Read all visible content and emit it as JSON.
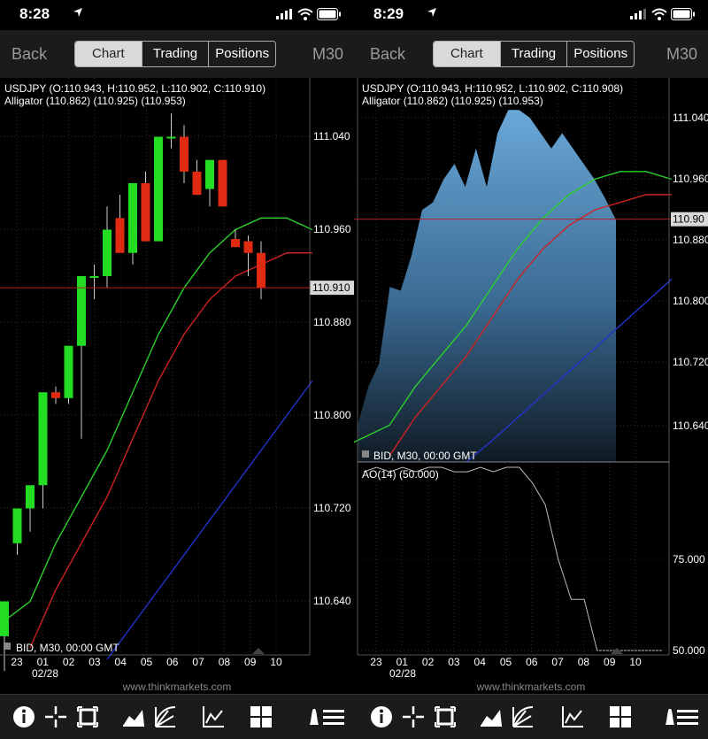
{
  "screens": [
    {
      "status": {
        "time": "8:28"
      },
      "nav": {
        "back": "Back",
        "tabs": [
          "Chart",
          "Trading",
          "Positions"
        ],
        "active": 0,
        "timeframe": "M30"
      },
      "chart": {
        "header": "USDJPY (O:110.943, H:110.952, L:110.902, C:110.910)",
        "indicator": "Alligator (110.862) (110.925) (110.953)",
        "price_labels": [
          "111.040",
          "110.960",
          "110.880",
          "110.800",
          "110.720",
          "110.640"
        ],
        "current_price": "110.910",
        "bid_label": "BID, M30, 00:00 GMT",
        "time_labels": [
          "23",
          "01",
          "02",
          "03",
          "04",
          "05",
          "06",
          "07",
          "08",
          "09",
          "10"
        ],
        "date_label": "02/28",
        "watermark": "www.thinkmarkets.com"
      }
    },
    {
      "status": {
        "time": "8:29"
      },
      "nav": {
        "back": "Back",
        "tabs": [
          "Chart",
          "Trading",
          "Positions"
        ],
        "active": 0,
        "timeframe": "M30"
      },
      "chart": {
        "header": "USDJPY (O:110.943, H:110.952, L:110.902, C:110.908)",
        "indicator": "Alligator (110.862) (110.925) (110.953)",
        "price_labels": [
          "111.040",
          "110.960",
          "110.880",
          "110.800",
          "110.720",
          "110.640"
        ],
        "current_price": "110.90",
        "bid_label": "BID, M30, 00:00 GMT",
        "osc_label": "AO(14) (50.000)",
        "osc_labels": [
          "75.000",
          "50.000"
        ],
        "time_labels": [
          "23",
          "01",
          "02",
          "03",
          "04",
          "05",
          "06",
          "07",
          "08",
          "09",
          "10"
        ],
        "date_label": "02/28",
        "watermark": "www.thinkmarkets.com"
      }
    }
  ],
  "toolbar_icons": [
    "info-icon",
    "crosshair-icon",
    "frame-icon",
    "chart-type-icon",
    "drawing-tools-icon",
    "indicators-icon",
    "layout-grid-icon",
    "menu-icon"
  ],
  "chart_data": [
    {
      "type": "candlestick",
      "title": "USDJPY (O:110.943, H:110.952, L:110.902, C:110.910)",
      "ylim": [
        110.59,
        111.1
      ],
      "candles": [
        {
          "o": 110.61,
          "h": 110.64,
          "l": 110.58,
          "c": 110.64
        },
        {
          "o": 110.69,
          "h": 110.71,
          "l": 110.68,
          "c": 110.72
        },
        {
          "o": 110.72,
          "h": 110.73,
          "l": 110.7,
          "c": 110.74
        },
        {
          "o": 110.74,
          "h": 110.82,
          "l": 110.72,
          "c": 110.82
        },
        {
          "o": 110.82,
          "h": 110.825,
          "l": 110.81,
          "c": 110.815
        },
        {
          "o": 110.815,
          "h": 110.86,
          "l": 110.81,
          "c": 110.86
        },
        {
          "o": 110.86,
          "h": 110.92,
          "l": 110.78,
          "c": 110.92
        },
        {
          "o": 110.92,
          "h": 110.93,
          "l": 110.9,
          "c": 110.92
        },
        {
          "o": 110.92,
          "h": 110.98,
          "l": 110.91,
          "c": 110.96
        },
        {
          "o": 110.97,
          "h": 110.99,
          "l": 110.94,
          "c": 110.94
        },
        {
          "o": 110.94,
          "h": 111.0,
          "l": 110.93,
          "c": 111.0
        },
        {
          "o": 111.0,
          "h": 111.01,
          "l": 110.95,
          "c": 110.95
        },
        {
          "o": 110.95,
          "h": 111.04,
          "l": 110.95,
          "c": 111.04
        },
        {
          "o": 111.04,
          "h": 111.06,
          "l": 111.03,
          "c": 111.04
        },
        {
          "o": 111.04,
          "h": 111.05,
          "l": 111.0,
          "c": 111.01
        },
        {
          "o": 111.01,
          "h": 111.02,
          "l": 110.99,
          "c": 110.99
        },
        {
          "o": 110.995,
          "h": 111.02,
          "l": 110.98,
          "c": 111.02
        },
        {
          "o": 111.02,
          "h": 111.02,
          "l": 110.98,
          "c": 110.98
        },
        {
          "o": 110.952,
          "h": 110.96,
          "l": 110.945,
          "c": 110.945
        },
        {
          "o": 110.95,
          "h": 110.955,
          "l": 110.92,
          "c": 110.94
        },
        {
          "o": 110.94,
          "h": 110.95,
          "l": 110.9,
          "c": 110.91
        }
      ],
      "series": [
        {
          "color": "#2bd12b",
          "values": [
            [
              -2,
              110.59
            ],
            [
              1,
              110.64
            ],
            [
              2,
              110.69
            ],
            [
              4,
              110.77
            ],
            [
              5,
              110.82
            ],
            [
              6,
              110.87
            ],
            [
              7,
              110.91
            ],
            [
              8,
              110.94
            ],
            [
              9,
              110.96
            ],
            [
              10,
              110.97
            ],
            [
              11,
              110.97
            ],
            [
              12,
              110.96
            ]
          ]
        },
        {
          "color": "#cc2222",
          "values": [
            [
              1,
              110.6
            ],
            [
              2,
              110.65
            ],
            [
              4,
              110.73
            ],
            [
              5,
              110.78
            ],
            [
              6,
              110.83
            ],
            [
              7,
              110.87
            ],
            [
              8,
              110.9
            ],
            [
              9,
              110.92
            ],
            [
              10,
              110.93
            ],
            [
              11,
              110.94
            ],
            [
              12,
              110.94
            ]
          ]
        },
        {
          "color": "#2233cc",
          "values": [
            [
              4,
              110.59
            ],
            [
              5,
              110.62
            ],
            [
              6,
              110.65
            ],
            [
              7,
              110.68
            ],
            [
              8,
              110.71
            ],
            [
              9,
              110.74
            ],
            [
              10,
              110.77
            ],
            [
              11,
              110.8
            ],
            [
              12,
              110.83
            ]
          ]
        }
      ]
    },
    {
      "type": "area",
      "title": "USDJPY (O:110.943, H:110.952, L:110.902, C:110.908)",
      "ylim": [
        110.59,
        111.1
      ],
      "close": [
        110.64,
        110.69,
        110.72,
        110.82,
        110.815,
        110.86,
        110.92,
        110.93,
        110.96,
        110.98,
        110.95,
        111.0,
        110.95,
        111.02,
        111.05,
        111.05,
        111.04,
        111.02,
        111.0,
        111.02,
        111.0,
        110.98,
        110.96,
        110.935,
        110.907
      ],
      "alligator": [
        {
          "color": "#2bd12b",
          "values": [
            [
              -2,
              110.59
            ],
            [
              1,
              110.64
            ],
            [
              2,
              110.69
            ],
            [
              4,
              110.77
            ],
            [
              5,
              110.82
            ],
            [
              6,
              110.87
            ],
            [
              7,
              110.91
            ],
            [
              8,
              110.94
            ],
            [
              9,
              110.96
            ],
            [
              10,
              110.97
            ],
            [
              11,
              110.97
            ],
            [
              12,
              110.96
            ]
          ]
        },
        {
          "color": "#cc2222",
          "values": [
            [
              1,
              110.6
            ],
            [
              2,
              110.65
            ],
            [
              4,
              110.73
            ],
            [
              5,
              110.78
            ],
            [
              6,
              110.83
            ],
            [
              7,
              110.87
            ],
            [
              8,
              110.9
            ],
            [
              9,
              110.92
            ],
            [
              10,
              110.93
            ],
            [
              11,
              110.94
            ],
            [
              12,
              110.94
            ]
          ]
        },
        {
          "color": "#2233cc",
          "values": [
            [
              4,
              110.59
            ],
            [
              5,
              110.62
            ],
            [
              6,
              110.65
            ],
            [
              7,
              110.68
            ],
            [
              8,
              110.71
            ],
            [
              9,
              110.74
            ],
            [
              10,
              110.77
            ],
            [
              11,
              110.8
            ],
            [
              12,
              110.83
            ]
          ]
        }
      ],
      "oscillator": {
        "name": "AO(14)",
        "ylim": [
          50,
          80
        ],
        "values": [
          [
            -1,
            99
          ],
          [
            -0.5,
            103
          ],
          [
            0,
            99
          ],
          [
            0.5,
            103
          ],
          [
            1,
            99
          ],
          [
            1.5,
            103
          ],
          [
            2,
            103
          ],
          [
            2.5,
            99
          ],
          [
            3,
            99
          ],
          [
            3.5,
            103
          ],
          [
            4,
            99
          ],
          [
            4.5,
            103
          ],
          [
            5,
            103
          ],
          [
            5.5,
            96
          ],
          [
            6,
            90
          ],
          [
            6.5,
            75
          ],
          [
            7,
            64
          ],
          [
            7.5,
            64
          ],
          [
            8,
            50
          ],
          [
            8.5,
            50
          ],
          [
            9,
            50
          ],
          [
            9.5,
            50
          ],
          [
            10,
            50
          ],
          [
            10.5,
            50
          ]
        ]
      }
    }
  ]
}
